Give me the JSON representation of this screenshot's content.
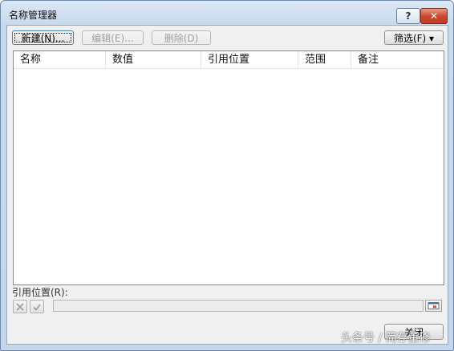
{
  "window": {
    "title": "名称管理器"
  },
  "titlebar": {
    "help_label": "?",
    "close_glyph": "✕"
  },
  "toolbar": {
    "new_label": "新建(N)...",
    "edit_label": "编辑(E)...",
    "delete_label": "删除(D)",
    "filter_label": "筛选(F) ▾"
  },
  "table": {
    "columns": [
      "名称",
      "数值",
      "引用位置",
      "范围",
      "备注"
    ],
    "rows": []
  },
  "refers_to": {
    "label": "引用位置(R):",
    "cancel_icon": "x-icon",
    "confirm_icon": "check-icon",
    "value": ""
  },
  "footer": {
    "close_label": "关闭"
  },
  "watermark": "头条号 / 简存董修",
  "colors": {
    "close_red": "#c8452c",
    "frame_blue": "#c4d6ec",
    "client_gray": "#f0f0f0"
  }
}
